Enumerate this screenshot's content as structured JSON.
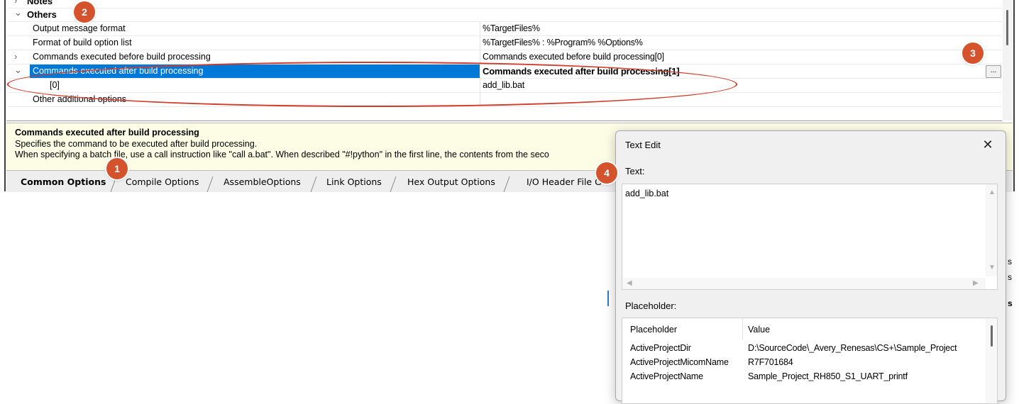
{
  "grid": {
    "rows": [
      {
        "name": "Notes",
        "value": "",
        "type": "category",
        "chevron": "›"
      },
      {
        "name": "Others",
        "value": "",
        "type": "category",
        "chevron": "⌄"
      },
      {
        "name": "Output message format",
        "value": "%TargetFiles%"
      },
      {
        "name": "Format of build option list",
        "value": "%TargetFiles% : %Program% %Options%"
      },
      {
        "name": "Commands executed before build processing",
        "value": "Commands executed before build processing[0]",
        "chevron": "›"
      },
      {
        "name": "Commands executed after build processing",
        "value": "Commands executed after build processing[1]",
        "chevron": "⌄",
        "selected": true
      },
      {
        "name": "[0]",
        "value": "add_lib.bat"
      },
      {
        "name": "Other additional options",
        "value": ""
      }
    ],
    "ellipsis_button": "..."
  },
  "description": {
    "title": "Commands executed after build processing",
    "line1": "Specifies the command to be executed after build processing.",
    "line2": "When specifying a batch file, use a call instruction like \"call a.bat\". When described \"#!python\" in the first line, the contents from the seco"
  },
  "tabs": [
    "Common Options",
    "Compile Options",
    "AssembleOptions",
    "Link Options",
    "Hex Output Options",
    "I/O Header File G"
  ],
  "badges": [
    "1",
    "2",
    "3",
    "4"
  ],
  "dialog": {
    "title": "Text Edit",
    "close": "✕",
    "text_label": "Text:",
    "text_value": "add_lib.bat",
    "placeholder_label": "Placeholder:",
    "table_headers": [
      "Placeholder",
      "Value"
    ],
    "table_rows": [
      [
        "ActiveProjectDir",
        "D:\\SourceCode\\_Avery_Renesas\\CS+\\Sample_Project"
      ],
      [
        "ActiveProjectMicomName",
        "R7F701684"
      ],
      [
        "ActiveProjectName",
        "Sample_Project_RH850_S1_UART_printf"
      ]
    ]
  },
  "peek": [
    "s",
    "s",
    "s"
  ],
  "colors": {
    "selection": "#0078d7",
    "annotation": "#d4532d",
    "ellipse": "#d23a2a",
    "description_bg": "#fdfde6"
  }
}
